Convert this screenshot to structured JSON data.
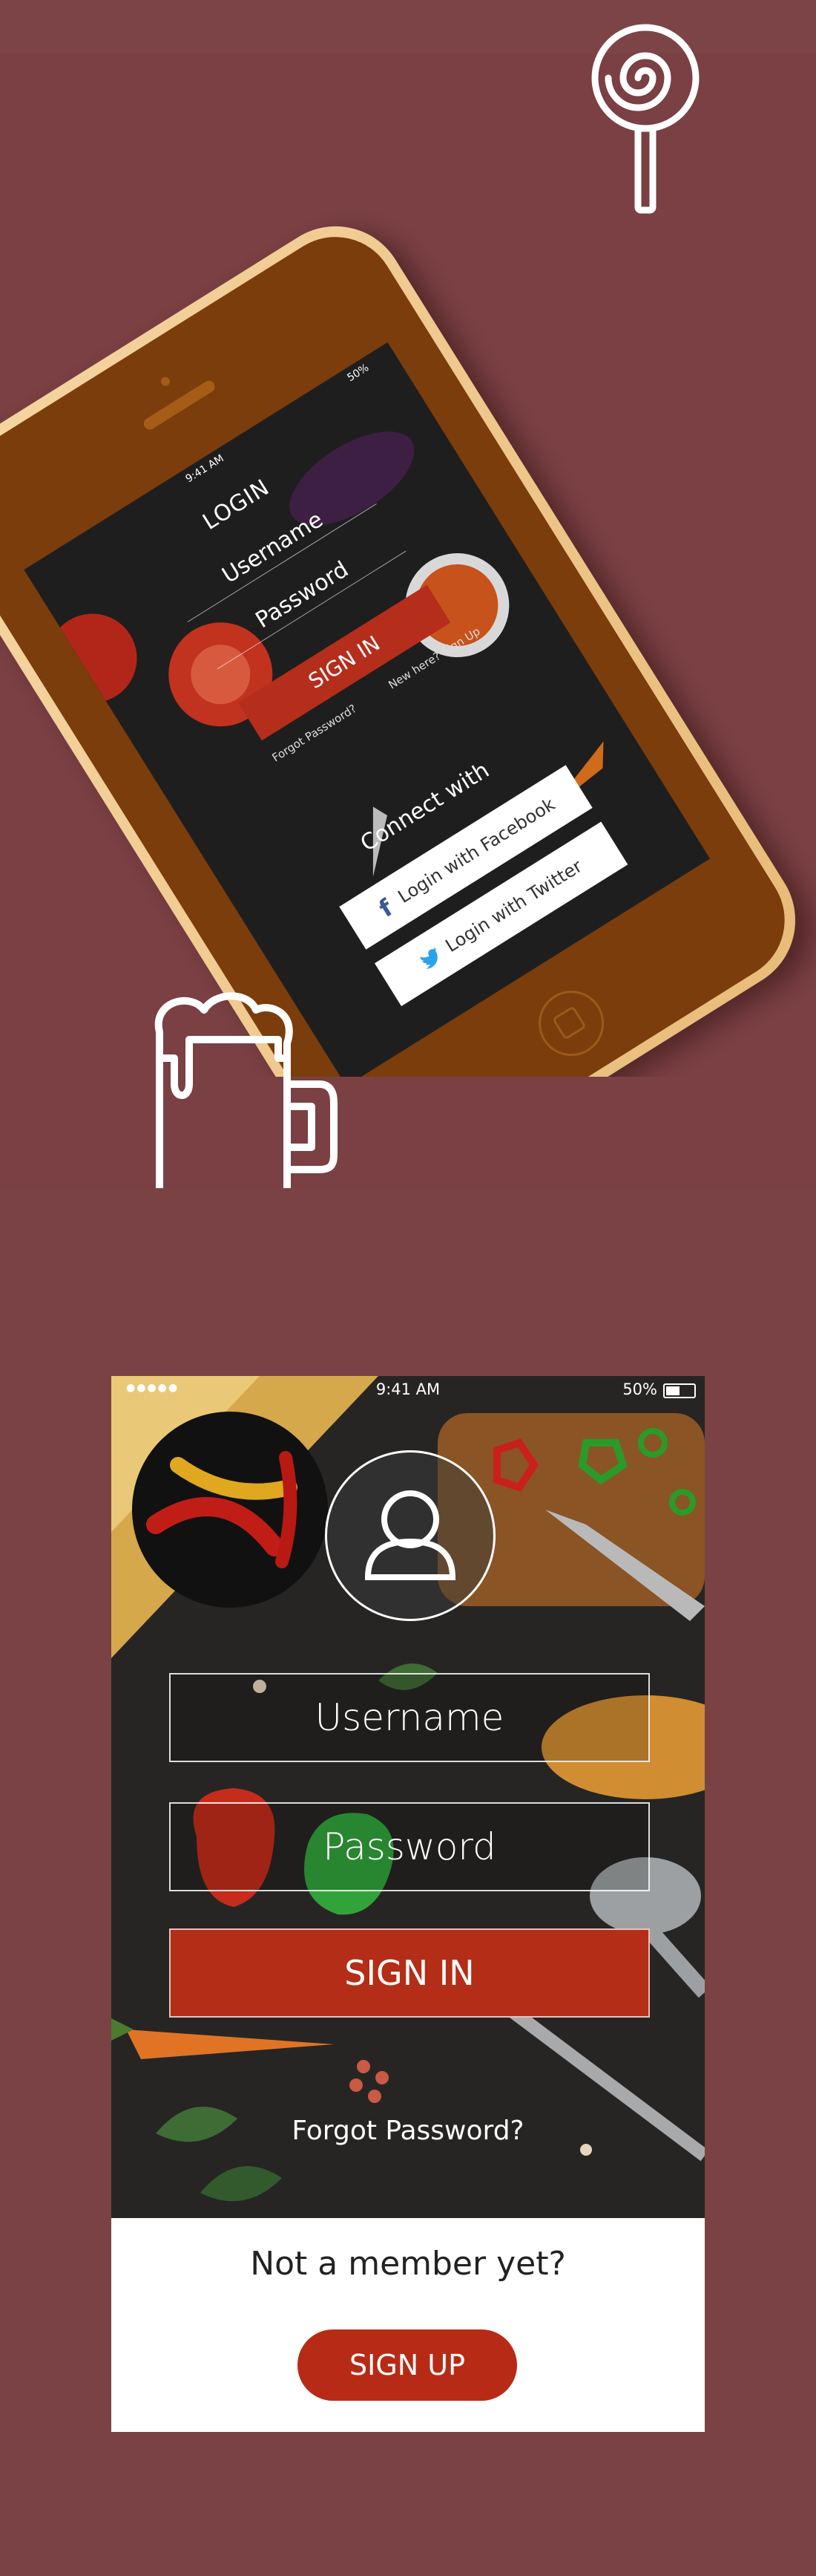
{
  "colors": {
    "background": "#7a4044",
    "accent_red": "#b42d16",
    "phone_gold": "#f0c98c",
    "white": "#ffffff"
  },
  "icons": [
    "lollipop-icon",
    "beer-mug-icon",
    "user-avatar-icon",
    "facebook-icon",
    "twitter-icon",
    "wifi-icon",
    "battery-icon"
  ],
  "tilted_phone": {
    "status_time": "9:41 AM",
    "status_battery": "50%",
    "title": "LOGIN",
    "username_placeholder": "Username",
    "password_placeholder": "Password",
    "signin_label": "SIGN IN",
    "forgot_label": "Forgot Password?",
    "new_here_label": "New here? Sign Up",
    "connect_label": "Connect with",
    "facebook_label": "Login with Facebook",
    "twitter_label": "Login with Twitter"
  },
  "app": {
    "status_time": "9:41 AM",
    "status_battery": "50%",
    "username_placeholder": "Username",
    "password_placeholder": "Password",
    "signin_label": "SIGN IN",
    "forgot_label": "Forgot Password?",
    "not_member_label": "Not a member yet?",
    "signup_label": "SIGN UP"
  }
}
